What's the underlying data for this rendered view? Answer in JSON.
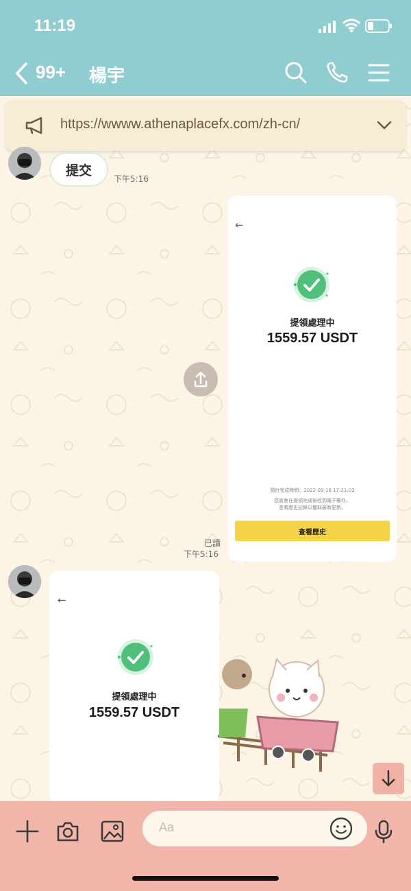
{
  "status_bar": {
    "time": "11:19"
  },
  "header": {
    "unread_count": "99+",
    "contact_name": "楊宇"
  },
  "announcement": {
    "url": "https://wwww.athenaplacefx.com/zh-cn/"
  },
  "messages": {
    "m1": {
      "text": "提交",
      "time": "下午5:16"
    },
    "m2": {
      "read_label": "已讀",
      "time": "下午5:16",
      "back_arrow": "←",
      "status": "提領處理中",
      "amount": "1559.57 USDT",
      "eta_line": "預計完成時間：2022-09-18 17:21:03",
      "note_line1": "您將會在提領完成後收到電子郵件。",
      "note_line2": "查看歷史記錄以獲取最新更新。",
      "button": "查看歷史"
    },
    "m3": {
      "back_arrow": "←",
      "status": "提領處理中",
      "amount": "1559.57 USDT"
    }
  },
  "input": {
    "placeholder": "Aa"
  },
  "colors": {
    "header": "#8fcdd1",
    "chat_bg": "#fcf5e6",
    "input_bar": "#f2b5a9",
    "accent_green": "#4fbf7a",
    "history_button": "#f5d348"
  }
}
